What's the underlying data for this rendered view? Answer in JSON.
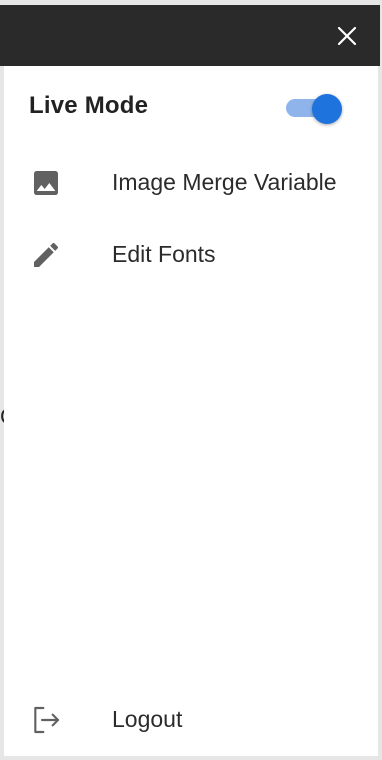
{
  "drawer": {
    "close_icon": "close-icon",
    "live_mode": {
      "label": "Live Mode",
      "enabled": true,
      "accent_color": "#1f73dd"
    },
    "items": [
      {
        "icon": "image-icon",
        "label": "Image Merge Variable"
      },
      {
        "icon": "pencil-icon",
        "label": "Edit Fonts"
      }
    ],
    "footer": {
      "icon": "logout-icon",
      "label": "Logout"
    }
  }
}
